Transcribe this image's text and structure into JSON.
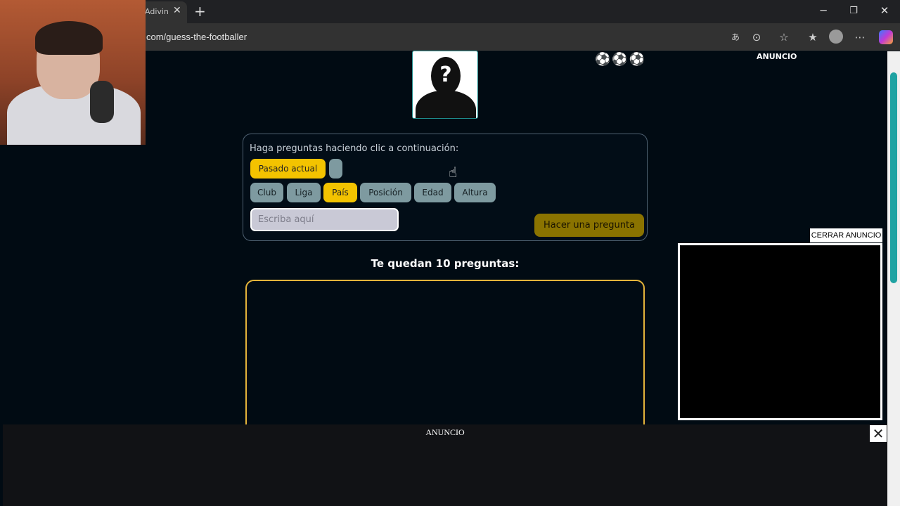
{
  "browser": {
    "tab_title": "Adivina",
    "tab_close": "✕",
    "new_tab": "+",
    "url": "com/guess-the-footballer",
    "minimize": "─",
    "restore": "❐",
    "close": "✕",
    "icons": [
      "translate-icon",
      "reader-icon",
      "favorite-icon",
      "favorites-icon",
      "profile-icon",
      "more-icon",
      "copilot-icon"
    ]
  },
  "page": {
    "portrait_symbol": "?",
    "lives": "⚽⚽⚽",
    "top_ad_label": "ANUNCIO",
    "questions": {
      "prompt": "Haga preguntas haciendo clic a continuación:",
      "time_options": [
        "Pasado actual",
        ""
      ],
      "categories": [
        "Club",
        "Liga",
        "País",
        "Posición",
        "Edad",
        "Altura"
      ],
      "selected_category": "País",
      "input_placeholder": "Escriba aquí",
      "ask_button": "Hacer una pregunta"
    },
    "remaining_text": "Te quedan 10 preguntas:"
  },
  "ads": {
    "close_ad": "CERRAR ANUNCIO",
    "bottom_label": "ANUNCIO",
    "bottom_close": "✕"
  },
  "colors": {
    "background": "#010b13",
    "accent_yellow": "#f3c300",
    "chip_gray": "#7e9aa0",
    "answer_border": "#e4b43a",
    "ask_button": "#8a7300"
  }
}
